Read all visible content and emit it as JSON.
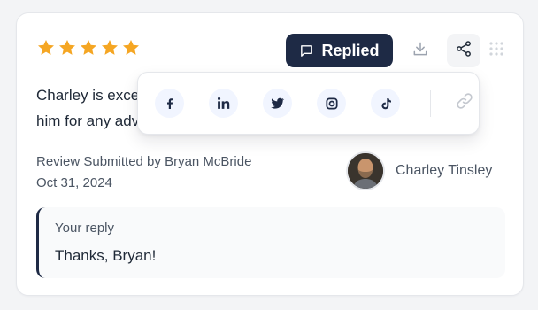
{
  "review": {
    "rating": 5,
    "rating_max": 5,
    "body": "Charley is exceptionally helpful, and I'd highly recommend\nhim for any advice.",
    "submitted_by": "Review Submitted by Bryan McBride",
    "date": "Oct 31, 2024"
  },
  "toolbar": {
    "replied_label": "Replied"
  },
  "reviewee": {
    "name": "Charley Tinsley"
  },
  "reply": {
    "label": "Your reply",
    "text": "Thanks, Bryan!"
  },
  "share_menu": {
    "items": [
      "facebook",
      "linkedin",
      "twitter",
      "instagram",
      "tiktok",
      "copy-link"
    ]
  },
  "colors": {
    "star": "#f5a623",
    "primary": "#1e2a45",
    "icon_gray": "#9ca3af",
    "social_bg": "#f1f5ff"
  }
}
